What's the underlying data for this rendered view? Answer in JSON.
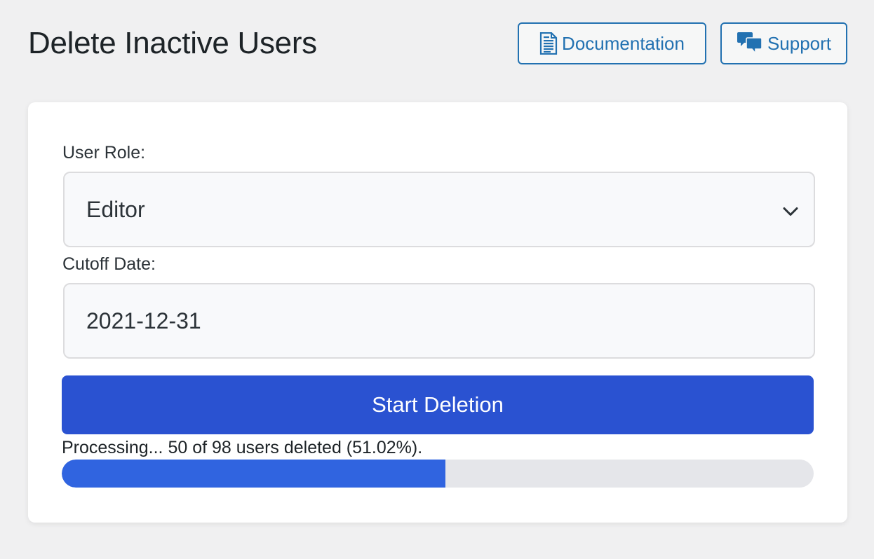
{
  "page": {
    "title": "Delete Inactive Users"
  },
  "header": {
    "documentation_label": "Documentation",
    "documentation_icon": "document-icon",
    "support_label": "Support",
    "support_icon": "speech-bubbles-icon"
  },
  "form": {
    "role_label": "User Role:",
    "role_value": "Editor",
    "role_icon": "chevron-down-icon",
    "date_label": "Cutoff Date:",
    "date_value": "2021-12-31",
    "submit_label": "Start Deletion"
  },
  "progress": {
    "text": "Processing... 50 of 98 users deleted (51.02%).",
    "deleted": 50,
    "total": 98,
    "percent": 51.02
  },
  "colors": {
    "accent": "#2271b1",
    "primary_button": "#2a52d1",
    "progress_fill": "#3064e0",
    "progress_track": "#e5e6ea"
  }
}
